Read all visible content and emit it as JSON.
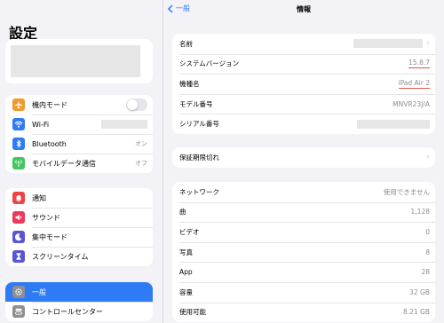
{
  "sidebar": {
    "title": "設定",
    "group1": [
      {
        "label": "機内モード",
        "icon": "airplane-icon",
        "color": "#f0992f",
        "toggle": true
      },
      {
        "label": "Wi-Fi",
        "icon": "wifi-icon",
        "color": "#2f7bf6",
        "redacted": true
      },
      {
        "label": "Bluetooth",
        "icon": "bluetooth-icon",
        "color": "#2f7bf6",
        "value": "オン"
      },
      {
        "label": "モバイルデータ通信",
        "icon": "antenna-icon",
        "color": "#44c560",
        "value": "オフ"
      }
    ],
    "group2": [
      {
        "label": "通知",
        "icon": "bell-icon",
        "color": "#ef4444"
      },
      {
        "label": "サウンド",
        "icon": "speaker-icon",
        "color": "#ee3a5a"
      },
      {
        "label": "集中モード",
        "icon": "moon-icon",
        "color": "#5a55d6"
      },
      {
        "label": "スクリーンタイム",
        "icon": "hourglass-icon",
        "color": "#5a55d6"
      }
    ],
    "group3": [
      {
        "label": "一般",
        "icon": "gear-icon",
        "color": "#8e8e93",
        "selected": true
      },
      {
        "label": "コントロールセンター",
        "icon": "switches-icon",
        "color": "#8e8e93"
      }
    ]
  },
  "header": {
    "back_label": "一般",
    "title": "情報"
  },
  "info_group": [
    {
      "label": "名前",
      "redacted": true,
      "chevron": true
    },
    {
      "label": "システムバージョン",
      "value": "15.8.7",
      "underline": true
    },
    {
      "label": "機種名",
      "value": "iPad Air 2",
      "underline": true
    },
    {
      "label": "モデル番号",
      "value": "MNVR23J/A"
    },
    {
      "label": "シリアル番号",
      "redacted": true
    }
  ],
  "warranty_group": [
    {
      "label": "保証期限切れ",
      "chevron": true
    }
  ],
  "stats_group": [
    {
      "label": "ネットワーク",
      "value": "使用できません"
    },
    {
      "label": "曲",
      "value": "1,128"
    },
    {
      "label": "ビデオ",
      "value": "0"
    },
    {
      "label": "写真",
      "value": "8"
    },
    {
      "label": "App",
      "value": "28"
    },
    {
      "label": "容量",
      "value": "32 GB"
    },
    {
      "label": "使用可能",
      "value": "8.21 GB"
    }
  ]
}
